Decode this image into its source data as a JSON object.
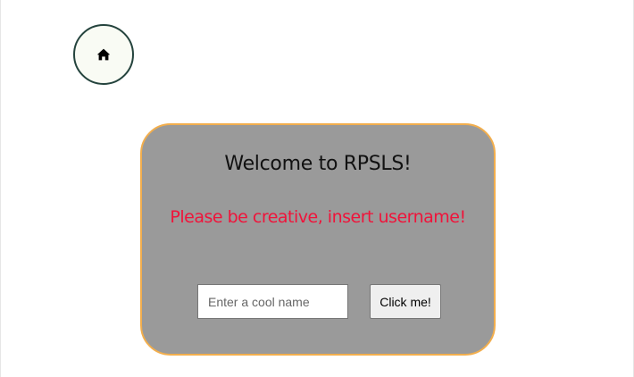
{
  "nav": {
    "home_icon": "home-icon"
  },
  "welcome_card": {
    "title": "Welcome to RPSLS!",
    "warning": "Please be creative, insert username!",
    "username_input": {
      "placeholder": "Enter a cool name",
      "value": ""
    },
    "submit_label": "Click me!"
  },
  "colors": {
    "card_background": "#9a9a9a",
    "card_border": "#f2ae4d",
    "warning_text": "#f0133a",
    "home_button_border": "#24433d",
    "home_button_background": "#f9fbf4"
  }
}
